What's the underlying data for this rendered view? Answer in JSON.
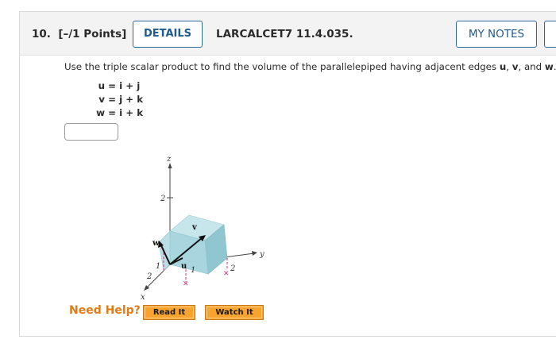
{
  "header": {
    "question_number": "10.",
    "points": "[–/1 Points]",
    "details_label": "DETAILS",
    "assignment_code": "LARCALCET7 11.4.035.",
    "my_notes_label": "MY NOTES"
  },
  "question": {
    "prompt_start": "Use the triple scalar product to find the volume of the parallelepiped having adjacent edges ",
    "u": "u",
    "sep1": ", ",
    "v": "v",
    "sep2": ", and ",
    "w": "w",
    "end": ".",
    "equations": [
      {
        "lhs": "u",
        "rhs": "= i + j"
      },
      {
        "lhs": "v",
        "rhs": "= j + k"
      },
      {
        "lhs": "w",
        "rhs": "= i + k"
      }
    ],
    "answer_value": ""
  },
  "figure": {
    "axis_z": "z",
    "axis_y": "y",
    "axis_x": "x",
    "tick_z2": "2",
    "tick_x1": "1",
    "tick_x2": "2",
    "tick_y1": "1",
    "tick_y2": "2",
    "vec_u": "u",
    "vec_v": "v",
    "vec_w": "w",
    "colors": {
      "face_top": "#c6e6ec",
      "face_side": "#8fc6cf",
      "face_front": "#a9d6de",
      "guide": "#d6337a"
    }
  },
  "help": {
    "label": "Need Help?",
    "read_it": "Read It",
    "watch_it": "Watch It"
  },
  "colors": {
    "accent": "#215a8d",
    "help_orange": "#e07b17",
    "button_orange": "#f8a330"
  }
}
